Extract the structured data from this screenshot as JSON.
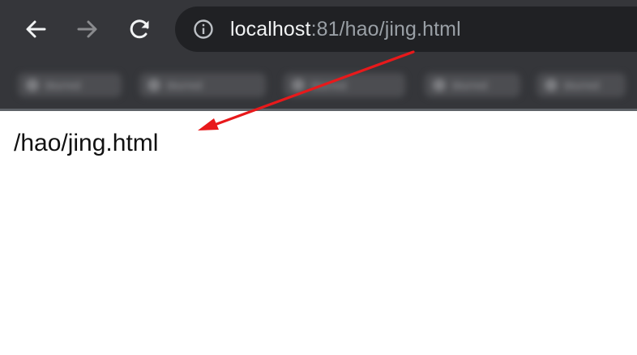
{
  "browser": {
    "back_icon": "arrow-left-icon",
    "forward_icon": "arrow-right-icon",
    "reload_icon": "reload-icon",
    "info_icon": "info-circle-icon",
    "address": {
      "host": "localhost",
      "rest": ":81/hao/jing.html"
    },
    "bookmarks": [
      {
        "label": "blurred"
      },
      {
        "label": "blurred"
      },
      {
        "label": "blurred"
      },
      {
        "label": "blurred"
      },
      {
        "label": "blurred"
      }
    ],
    "colors": {
      "chrome": "#35363a",
      "omnibox": "#202124",
      "host_text": "#f1f3f4",
      "path_text": "#9aa0a6"
    }
  },
  "page": {
    "path_text": "/hao/jing.html"
  },
  "annotation": {
    "type": "arrow",
    "color": "#e8191b",
    "from": "address-bar-path",
    "to": "page-path-text"
  }
}
